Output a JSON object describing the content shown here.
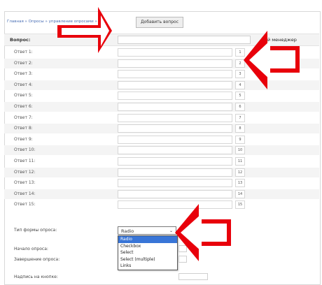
{
  "breadcrumb": "Главная » Опросы » управление опросами »",
  "add_question_button": "Добавить вопрос",
  "question_label": "Вопрос:",
  "right_header_label": "вый менеджер",
  "answers": [
    {
      "label": "Ответ 1:",
      "num": "1"
    },
    {
      "label": "Ответ 2:",
      "num": "2"
    },
    {
      "label": "Ответ 3:",
      "num": "3"
    },
    {
      "label": "Ответ 4:",
      "num": "4"
    },
    {
      "label": "Ответ 5:",
      "num": "5"
    },
    {
      "label": "Ответ 6:",
      "num": "6"
    },
    {
      "label": "Ответ 7:",
      "num": "7"
    },
    {
      "label": "Ответ 8:",
      "num": "8"
    },
    {
      "label": "Ответ 9:",
      "num": "9"
    },
    {
      "label": "Ответ 10:",
      "num": "10"
    },
    {
      "label": "Ответ 11:",
      "num": "11"
    },
    {
      "label": "Ответ 12:",
      "num": "12"
    },
    {
      "label": "Ответ 13:",
      "num": "13"
    },
    {
      "label": "Ответ 14:",
      "num": "14"
    },
    {
      "label": "Ответ 15:",
      "num": "15"
    }
  ],
  "form_type_label": "Тип формы опроса:",
  "form_type_selected": "Radio",
  "form_type_options": [
    "Radio",
    "Checkbox",
    "Select",
    "Select (multiple)",
    "Links"
  ],
  "start_label": "Начало опроса:",
  "end_label": "Завершение опроса:",
  "caption_label": "Надпись на кнопке:",
  "arrow_color": "#e8000b"
}
